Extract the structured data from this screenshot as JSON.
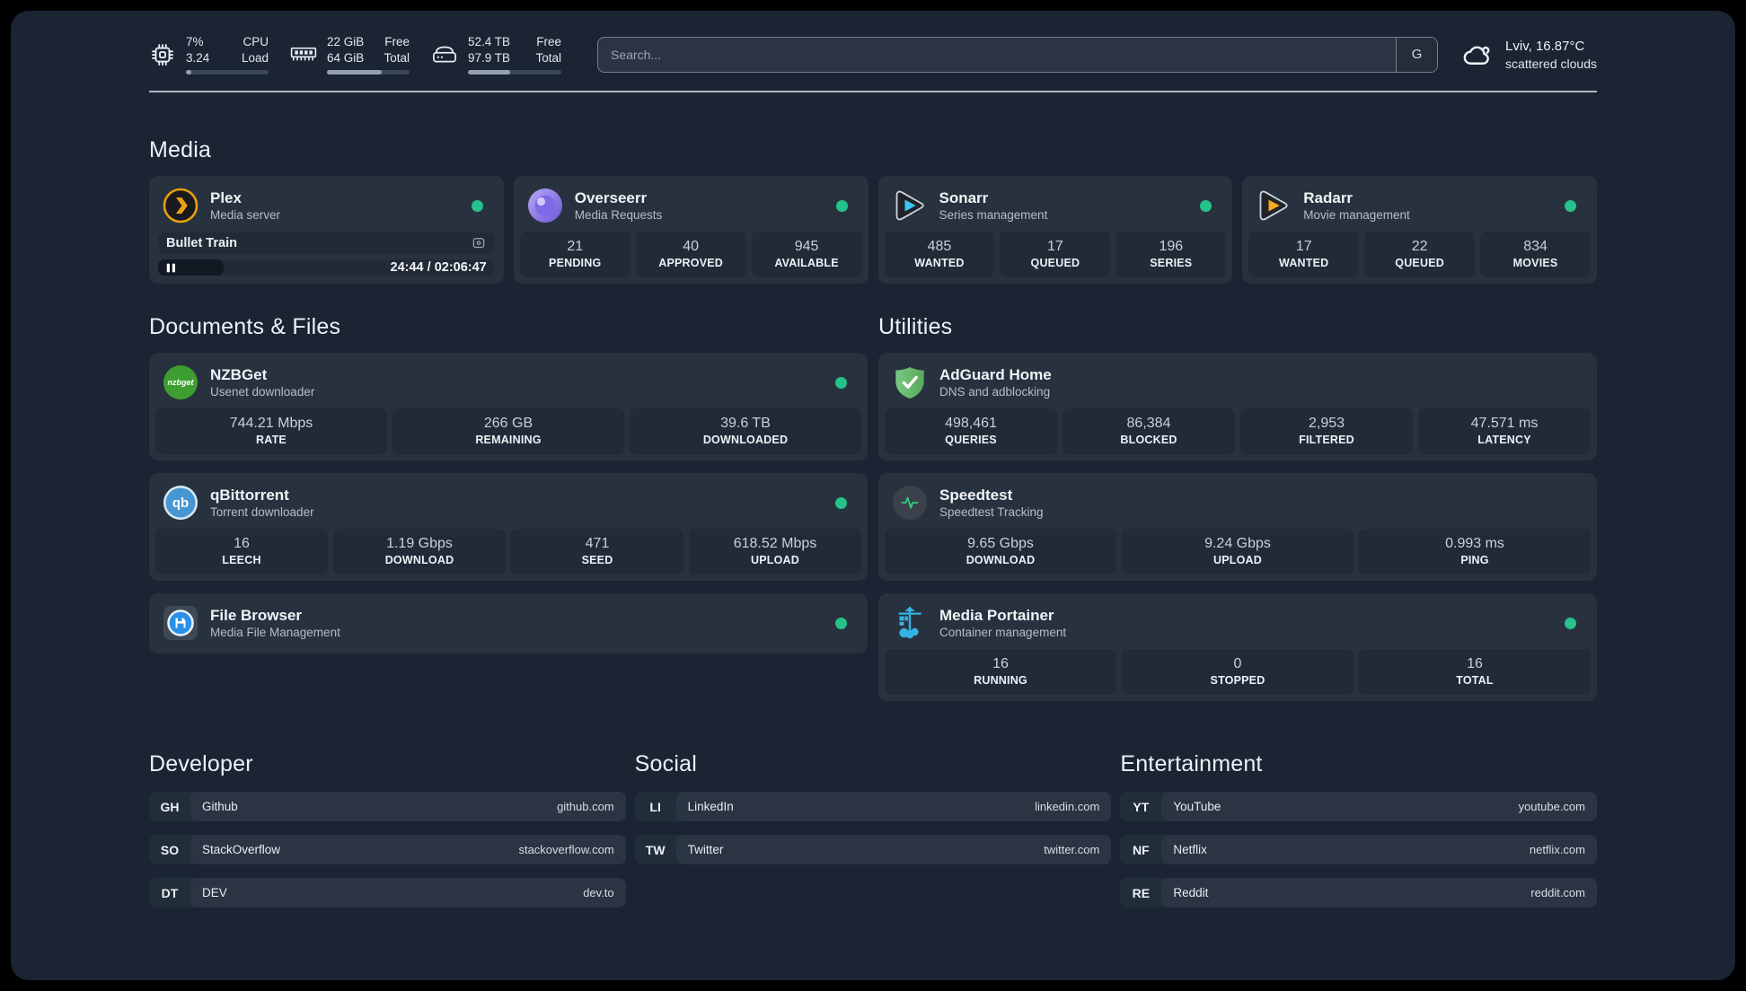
{
  "header": {
    "cpu": {
      "value1": "7%",
      "value2": "3.24",
      "label1": "CPU",
      "label2": "Load",
      "progress": 7
    },
    "memory": {
      "value1": "22 GiB",
      "value2": "64 GiB",
      "label1": "Free",
      "label2": "Total",
      "progress": 66
    },
    "storage": {
      "value1": "52.4 TB",
      "value2": "97.9 TB",
      "label1": "Free",
      "label2": "Total",
      "progress": 45
    },
    "search_placeholder": "Search...",
    "search_engine": "G",
    "weather_main": "Lviv, 16.87°C",
    "weather_desc": "scattered clouds"
  },
  "media": {
    "title": "Media",
    "plex": {
      "name": "Plex",
      "subtitle": "Media server",
      "now_playing": "Bullet Train",
      "time": "24:44 / 02:06:47",
      "progress": 19.5
    },
    "overseerr": {
      "name": "Overseerr",
      "subtitle": "Media Requests",
      "stats": [
        {
          "value": "21",
          "label": "PENDING"
        },
        {
          "value": "40",
          "label": "APPROVED"
        },
        {
          "value": "945",
          "label": "AVAILABLE"
        }
      ]
    },
    "sonarr": {
      "name": "Sonarr",
      "subtitle": "Series management",
      "stats": [
        {
          "value": "485",
          "label": "WANTED"
        },
        {
          "value": "17",
          "label": "QUEUED"
        },
        {
          "value": "196",
          "label": "SERIES"
        }
      ]
    },
    "radarr": {
      "name": "Radarr",
      "subtitle": "Movie management",
      "stats": [
        {
          "value": "17",
          "label": "WANTED"
        },
        {
          "value": "22",
          "label": "QUEUED"
        },
        {
          "value": "834",
          "label": "MOVIES"
        }
      ]
    }
  },
  "documents": {
    "title": "Documents & Files",
    "nzbget": {
      "name": "NZBGet",
      "subtitle": "Usenet downloader",
      "icon_text": "nzbget",
      "stats": [
        {
          "value": "744.21 Mbps",
          "label": "RATE"
        },
        {
          "value": "266 GB",
          "label": "REMAINING"
        },
        {
          "value": "39.6 TB",
          "label": "DOWNLOADED"
        }
      ]
    },
    "qbittorrent": {
      "name": "qBittorrent",
      "subtitle": "Torrent downloader",
      "icon_text": "qb",
      "stats": [
        {
          "value": "16",
          "label": "LEECH"
        },
        {
          "value": "1.19 Gbps",
          "label": "DOWNLOAD"
        },
        {
          "value": "471",
          "label": "SEED"
        },
        {
          "value": "618.52 Mbps",
          "label": "UPLOAD"
        }
      ]
    },
    "filebrowser": {
      "name": "File Browser",
      "subtitle": "Media File Management"
    }
  },
  "utilities": {
    "title": "Utilities",
    "adguard": {
      "name": "AdGuard Home",
      "subtitle": "DNS and adblocking",
      "stats": [
        {
          "value": "498,461",
          "label": "QUERIES"
        },
        {
          "value": "86,384",
          "label": "BLOCKED"
        },
        {
          "value": "2,953",
          "label": "FILTERED"
        },
        {
          "value": "47.571 ms",
          "label": "LATENCY"
        }
      ]
    },
    "speedtest": {
      "name": "Speedtest",
      "subtitle": "Speedtest Tracking",
      "stats": [
        {
          "value": "9.65 Gbps",
          "label": "DOWNLOAD"
        },
        {
          "value": "9.24 Gbps",
          "label": "UPLOAD"
        },
        {
          "value": "0.993 ms",
          "label": "PING"
        }
      ]
    },
    "portainer": {
      "name": "Media Portainer",
      "subtitle": "Container management",
      "stats": [
        {
          "value": "16",
          "label": "RUNNING"
        },
        {
          "value": "0",
          "label": "STOPPED"
        },
        {
          "value": "16",
          "label": "TOTAL"
        }
      ]
    }
  },
  "links": {
    "developer": {
      "title": "Developer",
      "items": [
        {
          "abbr": "GH",
          "name": "Github",
          "url": "github.com"
        },
        {
          "abbr": "SO",
          "name": "StackOverflow",
          "url": "stackoverflow.com"
        },
        {
          "abbr": "DT",
          "name": "DEV",
          "url": "dev.to"
        }
      ]
    },
    "social": {
      "title": "Social",
      "items": [
        {
          "abbr": "LI",
          "name": "LinkedIn",
          "url": "linkedin.com"
        },
        {
          "abbr": "TW",
          "name": "Twitter",
          "url": "twitter.com"
        }
      ]
    },
    "entertainment": {
      "title": "Entertainment",
      "items": [
        {
          "abbr": "YT",
          "name": "YouTube",
          "url": "youtube.com"
        },
        {
          "abbr": "NF",
          "name": "Netflix",
          "url": "netflix.com"
        },
        {
          "abbr": "RE",
          "name": "Reddit",
          "url": "reddit.com"
        }
      ]
    }
  },
  "colors": {
    "background": "#1a2433",
    "card": "#28323e",
    "stat_box": "#212a36",
    "status_green": "#26c28c",
    "plex_amber": "#e8a00d",
    "overseerr_purple": "#7e6ae6",
    "sonarr_cyan": "#3ac6f3",
    "radarr_orange": "#f7a823",
    "nzbget_green": "#3d9f32",
    "qbittorrent_blue": "#4796d1",
    "adguard_green": "#68bd6e",
    "speedtest_green": "#2fd37f",
    "filebrowser_blue": "#2a90e8",
    "portainer_blue": "#35b2e5"
  }
}
